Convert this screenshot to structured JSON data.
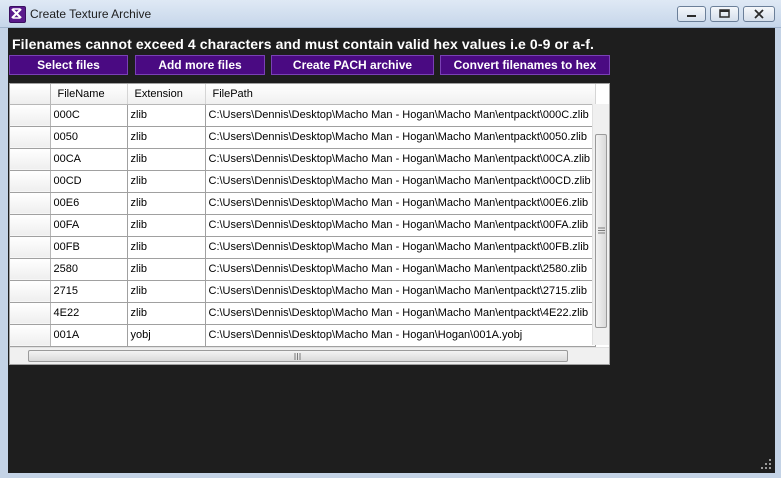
{
  "window": {
    "title": "Create Texture Archive",
    "icon": "app-x-icon",
    "controls": [
      "minimize-icon",
      "maximize-icon",
      "close-icon"
    ]
  },
  "notice": "Filenames cannot exceed 4 characters and must contain valid hex values i.e 0-9 or a-f.",
  "buttons": {
    "select_files": "Select files",
    "add_more_files": "Add more files",
    "create_pach": "Create PACH archive",
    "convert_hex": "Convert filenames to hex"
  },
  "grid": {
    "columns": [
      "FileName",
      "Extension",
      "FilePath"
    ],
    "rows": [
      [
        "000C",
        "zlib",
        "C:\\Users\\Dennis\\Desktop\\Macho Man - Hogan\\Macho Man\\entpackt\\000C.zlib"
      ],
      [
        "0050",
        "zlib",
        "C:\\Users\\Dennis\\Desktop\\Macho Man - Hogan\\Macho Man\\entpackt\\0050.zlib"
      ],
      [
        "00CA",
        "zlib",
        "C:\\Users\\Dennis\\Desktop\\Macho Man - Hogan\\Macho Man\\entpackt\\00CA.zlib"
      ],
      [
        "00CD",
        "zlib",
        "C:\\Users\\Dennis\\Desktop\\Macho Man - Hogan\\Macho Man\\entpackt\\00CD.zlib"
      ],
      [
        "00E6",
        "zlib",
        "C:\\Users\\Dennis\\Desktop\\Macho Man - Hogan\\Macho Man\\entpackt\\00E6.zlib"
      ],
      [
        "00FA",
        "zlib",
        "C:\\Users\\Dennis\\Desktop\\Macho Man - Hogan\\Macho Man\\entpackt\\00FA.zlib"
      ],
      [
        "00FB",
        "zlib",
        "C:\\Users\\Dennis\\Desktop\\Macho Man - Hogan\\Macho Man\\entpackt\\00FB.zlib"
      ],
      [
        "2580",
        "zlib",
        "C:\\Users\\Dennis\\Desktop\\Macho Man - Hogan\\Macho Man\\entpackt\\2580.zlib"
      ],
      [
        "2715",
        "zlib",
        "C:\\Users\\Dennis\\Desktop\\Macho Man - Hogan\\Macho Man\\entpackt\\2715.zlib"
      ],
      [
        "4E22",
        "zlib",
        "C:\\Users\\Dennis\\Desktop\\Macho Man - Hogan\\Macho Man\\entpackt\\4E22.zlib"
      ],
      [
        "001A",
        "yobj",
        "C:\\Users\\Dennis\\Desktop\\Macho Man - Hogan\\Hogan\\001A.yobj"
      ]
    ]
  },
  "colors": {
    "background": "#1e1e1e",
    "button": "#4a0a82",
    "notice_text": "#ffffff"
  }
}
